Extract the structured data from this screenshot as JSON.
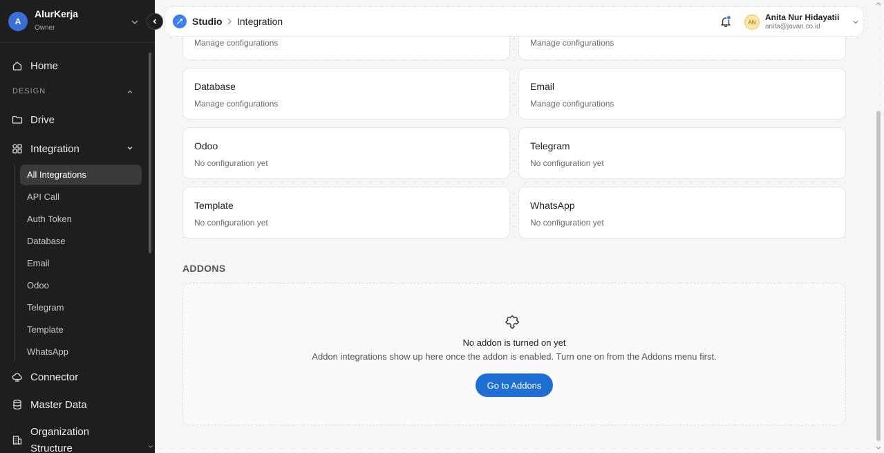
{
  "workspace": {
    "initial": "A",
    "name": "AlurKerja",
    "role": "Owner"
  },
  "sidebar": {
    "home": "Home",
    "section_design": "DESIGN",
    "drive": "Drive",
    "integration": "Integration",
    "sub_items": [
      "All Integrations",
      "API Call",
      "Auth Token",
      "Database",
      "Email",
      "Odoo",
      "Telegram",
      "Template",
      "WhatsApp"
    ],
    "connector": "Connector",
    "master_data": "Master Data",
    "org_line1": "Organization",
    "org_line2": "Structure"
  },
  "topbar": {
    "studio": "Studio",
    "current": "Integration",
    "user_initials": "AN",
    "user_name": "Anita Nur Hidayatii",
    "user_email": "anita@javan.co.id"
  },
  "cards": [
    {
      "title": "",
      "status": "Manage configurations"
    },
    {
      "title": "",
      "status": "Manage configurations"
    },
    {
      "title": "Database",
      "status": "Manage configurations"
    },
    {
      "title": "Email",
      "status": "Manage configurations"
    },
    {
      "title": "Odoo",
      "status": "No configuration yet"
    },
    {
      "title": "Telegram",
      "status": "No configuration yet"
    },
    {
      "title": "Template",
      "status": "No configuration yet"
    },
    {
      "title": "WhatsApp",
      "status": "No configuration yet"
    }
  ],
  "addons": {
    "label": "ADDONS",
    "empty_title": "No addon is turned on yet",
    "empty_desc": "Addon integrations show up here once the addon is enabled. Turn one on from the Addons menu first.",
    "button": "Go to Addons"
  },
  "colors": {
    "accent": "#1f6ed4",
    "sidebar_bg": "#1e1e1e",
    "studio_icon": "#3b7ff0"
  }
}
